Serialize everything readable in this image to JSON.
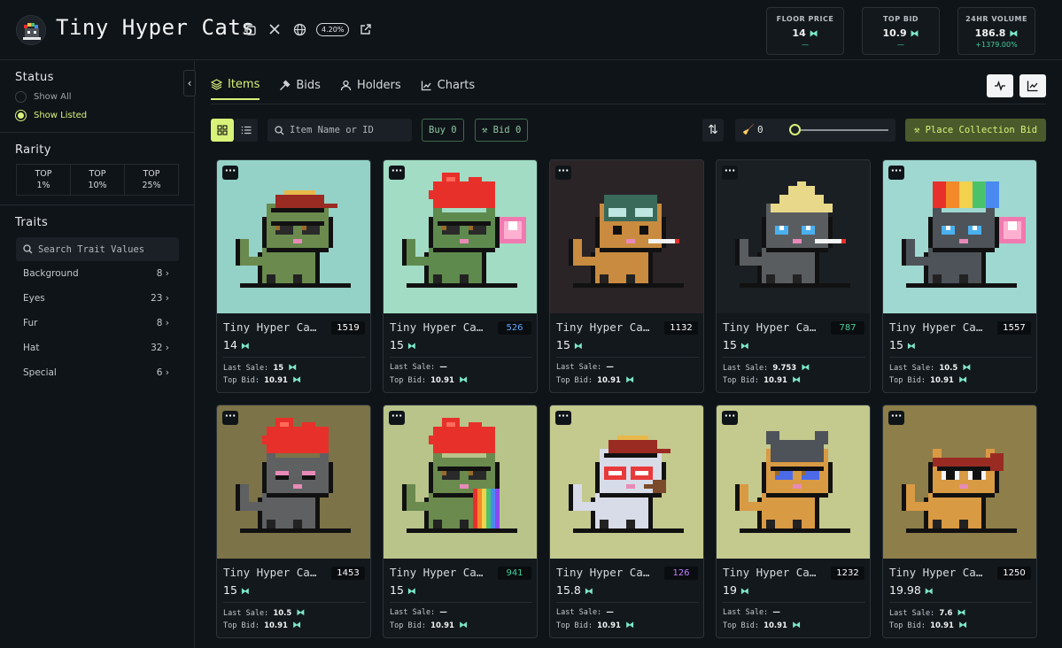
{
  "app": {
    "title": "Tiny Hyper Cats",
    "royalty_badge": "4.20%"
  },
  "stats": [
    {
      "label": "FLOOR PRICE",
      "value": "14",
      "sub": "—",
      "sub_color": "#45d09c"
    },
    {
      "label": "TOP BID",
      "value": "10.9",
      "sub": "—",
      "sub_color": "#45d09c"
    },
    {
      "label": "24HR VOLUME",
      "value": "186.8",
      "sub": "+1379.00%",
      "sub_color": "#45d09c"
    }
  ],
  "sidebar": {
    "status_title": "Status",
    "status_options": [
      {
        "label": "Show All",
        "selected": false
      },
      {
        "label": "Show Listed",
        "selected": true
      }
    ],
    "rarity_title": "Rarity",
    "rarity_options": [
      {
        "line1": "TOP",
        "line2": "1%"
      },
      {
        "line1": "TOP",
        "line2": "10%"
      },
      {
        "line1": "TOP",
        "line2": "25%"
      }
    ],
    "traits_title": "Traits",
    "trait_search_placeholder": "Search Trait Values",
    "traits": [
      {
        "name": "Background",
        "count": "8"
      },
      {
        "name": "Eyes",
        "count": "23"
      },
      {
        "name": "Fur",
        "count": "8"
      },
      {
        "name": "Hat",
        "count": "32"
      },
      {
        "name": "Special",
        "count": "6"
      }
    ]
  },
  "tabs": [
    {
      "label": "Items",
      "icon": "layers-icon",
      "active": true
    },
    {
      "label": "Bids",
      "icon": "gavel-icon",
      "active": false
    },
    {
      "label": "Holders",
      "icon": "user-icon",
      "active": false
    },
    {
      "label": "Charts",
      "icon": "chart-icon",
      "active": false
    }
  ],
  "toolbar": {
    "search_placeholder": "Item Name or ID",
    "buy_label": "Buy 0",
    "bid_label": "Bid 0",
    "sweep_value": "0",
    "sweep_fraction": 0,
    "place_bid_label": "Place Collection Bid"
  },
  "card_labels": {
    "last_sale": "Last Sale:",
    "top_bid": "Top Bid:"
  },
  "items": [
    {
      "name": "Tiny Hyper Cats",
      "id": "1519",
      "id_color": "#ffffff",
      "price": "14",
      "last_sale": "15",
      "last_sale_has_icon": true,
      "top_bid": "10.91",
      "bg": "#94d2c8",
      "fur": "#6a8a4e",
      "hat": "cap",
      "hat_color": "#9a2b23",
      "eyes": "shades",
      "extra": "none"
    },
    {
      "name": "Tiny Hyper Cats",
      "id": "526",
      "id_color": "#5aa9ff",
      "price": "15",
      "last_sale": "—",
      "last_sale_has_icon": false,
      "top_bid": "10.91",
      "bg": "#a2dcc4",
      "fur": "#5e8a4e",
      "hat": "mohawk",
      "hat_color": "#e8302a",
      "eyes": "shades",
      "extra": "bubble"
    },
    {
      "name": "Tiny Hyper Cats",
      "id": "1132",
      "id_color": "#ffffff",
      "price": "15",
      "last_sale": "—",
      "last_sale_has_icon": false,
      "top_bid": "10.91",
      "bg": "#2a2427",
      "fur": "#c98b3f",
      "hat": "aviator",
      "hat_color": "#3a6a5a",
      "eyes": "goggles",
      "extra": "cigarette"
    },
    {
      "name": "Tiny Hyper Cats",
      "id": "787",
      "id_color": "#45d09c",
      "price": "15",
      "last_sale": "9.753",
      "last_sale_has_icon": true,
      "top_bid": "10.91",
      "bg": "#1a1f23",
      "fur": "#5a5d60",
      "hat": "conical",
      "hat_color": "#e8d98a",
      "eyes": "blue",
      "extra": "cigarette"
    },
    {
      "name": "Tiny Hyper Cats",
      "id": "1557",
      "id_color": "#ffffff",
      "price": "15",
      "last_sale": "10.5",
      "last_sale_has_icon": true,
      "top_bid": "10.91",
      "bg": "#9fd8d0",
      "fur": "#4d5358",
      "hat": "rainbow",
      "hat_color": "#e8302a",
      "eyes": "blue",
      "extra": "bubble"
    },
    {
      "name": "Tiny Hyper Cats",
      "id": "1453",
      "id_color": "#ffffff",
      "price": "15",
      "last_sale": "10.5",
      "last_sale_has_icon": true,
      "top_bid": "10.91",
      "bg": "#7d7348",
      "fur": "#5e6062",
      "hat": "mohawk",
      "hat_color": "#e8302a",
      "eyes": "pink",
      "extra": "none"
    },
    {
      "name": "Tiny Hyper Cats",
      "id": "941",
      "id_color": "#45d09c",
      "price": "15",
      "last_sale": "—",
      "last_sale_has_icon": false,
      "top_bid": "10.91",
      "bg": "#b8c48a",
      "fur": "#6a8a4e",
      "hat": "mohawk",
      "hat_color": "#e8302a",
      "eyes": "shades",
      "extra": "rainbow"
    },
    {
      "name": "Tiny Hyper Cats",
      "id": "126",
      "id_color": "#c080ff",
      "price": "15.8",
      "last_sale": "—",
      "last_sale_has_icon": false,
      "top_bid": "10.91",
      "bg": "#c4c98e",
      "fur": "#d8dce8",
      "hat": "cap",
      "hat_color": "#9a2b23",
      "eyes": "red",
      "extra": "pipe"
    },
    {
      "name": "Tiny Hyper Cats",
      "id": "1232",
      "id_color": "#ffffff",
      "price": "19",
      "last_sale": "—",
      "last_sale_has_icon": false,
      "top_bid": "10.91",
      "bg": "#c4c98e",
      "fur": "#d99a44",
      "hat": "ears",
      "hat_color": "#4d5358",
      "eyes": "shades-blue",
      "extra": "none"
    },
    {
      "name": "Tiny Hyper Cats",
      "id": "1250",
      "id_color": "#ffffff",
      "price": "19.98",
      "last_sale": "7.6",
      "last_sale_has_icon": true,
      "top_bid": "10.91",
      "bg": "#8e7e4a",
      "fur": "#d99a44",
      "hat": "bandana",
      "hat_color": "#9a2b23",
      "eyes": "glasses",
      "extra": "none"
    }
  ]
}
